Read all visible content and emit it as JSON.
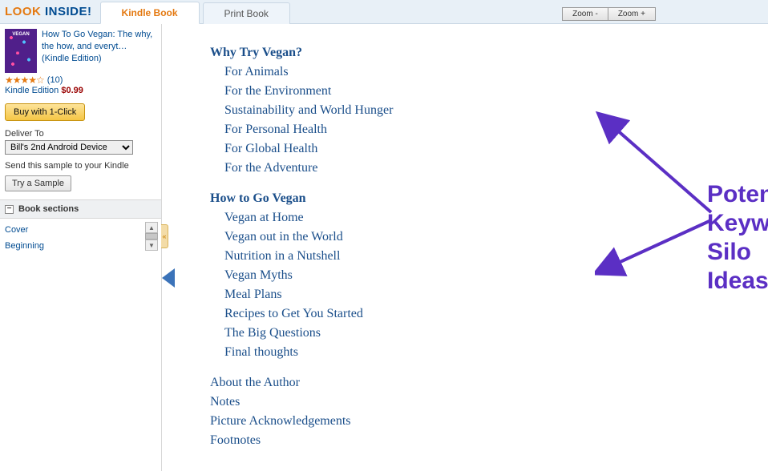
{
  "header": {
    "look": "LOOK",
    "inside": " INSIDE!",
    "tab_kindle": "Kindle Book",
    "tab_print": "Print Book",
    "zoom_out": "Zoom -",
    "zoom_in": "Zoom +"
  },
  "sidebar": {
    "title": "How To Go Vegan: The why, the how, and everyt… (Kindle Edition)",
    "stars": "★★★★☆",
    "rating_count": "(10)",
    "edition_label": "Kindle Edition",
    "price": "$0.99",
    "buy_label": "Buy with 1-Click",
    "deliver_label": "Deliver To",
    "deliver_value": "Bill's 2nd Android Device",
    "sample_text": "Send this sample to your Kindle",
    "sample_btn": "Try a Sample",
    "sections_header": "Book sections",
    "collapse_glyph": "«",
    "sections": [
      "Cover",
      "Beginning"
    ]
  },
  "toc": {
    "groups": [
      {
        "head": "Why Try Vegan?",
        "items": [
          "For Animals",
          "For the Environment",
          "Sustainability and World Hunger",
          "For Personal Health",
          "For Global Health",
          "For the Adventure"
        ]
      },
      {
        "head": "How to Go Vegan",
        "items": [
          "Vegan at Home",
          "Vegan out in the World",
          "Nutrition in a Nutshell",
          "Vegan Myths",
          "Meal Plans",
          "Recipes to Get You Started",
          "The Big Questions",
          "Final thoughts"
        ]
      }
    ],
    "tail": [
      "About the Author",
      "Notes",
      "Picture Acknowledgements",
      "Footnotes"
    ]
  },
  "annotation": {
    "line1": "Potential",
    "line2": "Keyword",
    "line3": "Silo Ideas"
  }
}
